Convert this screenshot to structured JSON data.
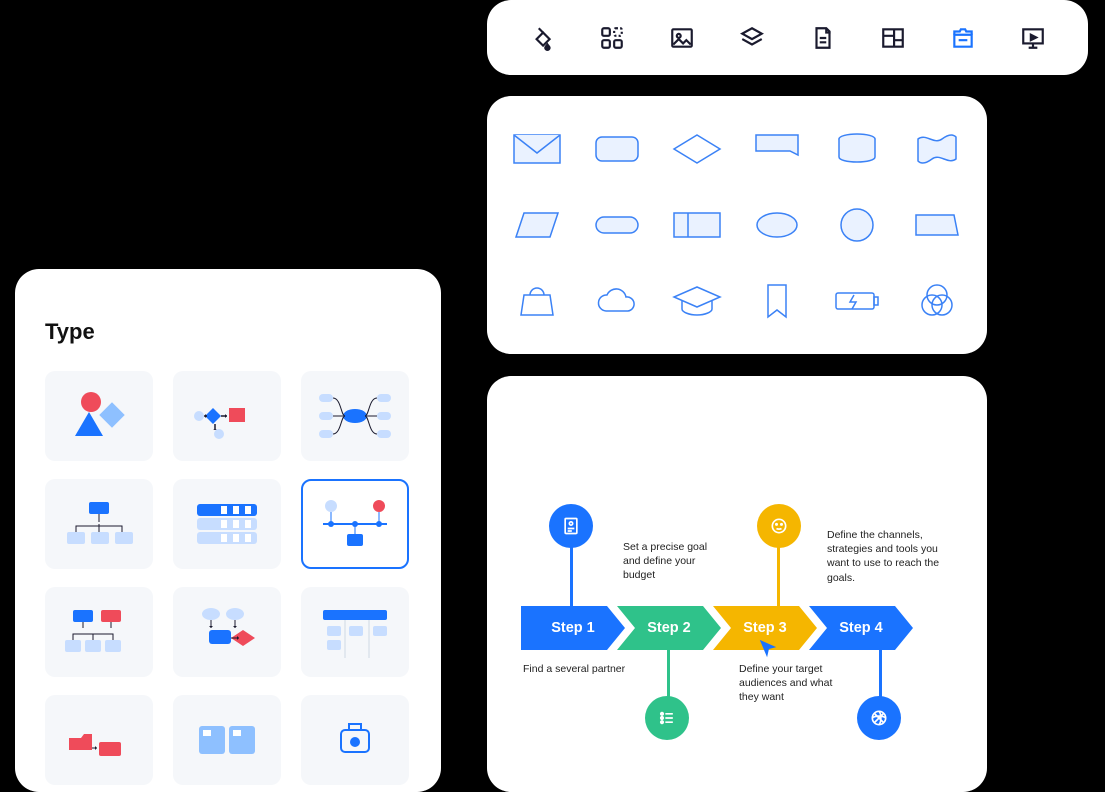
{
  "toolbar": {
    "items": [
      {
        "name": "fill-icon"
      },
      {
        "name": "apps-icon"
      },
      {
        "name": "image-icon"
      },
      {
        "name": "layers-icon"
      },
      {
        "name": "document-icon"
      },
      {
        "name": "layout-icon"
      },
      {
        "name": "templates-icon",
        "active": true
      },
      {
        "name": "presentation-icon"
      }
    ]
  },
  "shapes": {
    "items": [
      "envelope",
      "rounded-rect",
      "diamond",
      "flag",
      "cylinder",
      "wave-flag",
      "parallelogram",
      "pill",
      "split-rect",
      "ellipse",
      "circle",
      "trapezoid",
      "shopping-bag",
      "cloud",
      "graduation-cap",
      "bookmark",
      "battery",
      "venn"
    ]
  },
  "typePanel": {
    "title": "Type",
    "tiles": [
      {
        "name": "basic-shapes"
      },
      {
        "name": "flowchart"
      },
      {
        "name": "mindmap"
      },
      {
        "name": "org-chart"
      },
      {
        "name": "compare-table"
      },
      {
        "name": "timeline",
        "selected": true
      },
      {
        "name": "tree-diagram"
      },
      {
        "name": "decision-flow"
      },
      {
        "name": "kanban"
      },
      {
        "name": "folder-flow"
      },
      {
        "name": "cards"
      },
      {
        "name": "state"
      }
    ]
  },
  "steps": {
    "arrows": [
      {
        "label": "Step 1",
        "color": "c-blue"
      },
      {
        "label": "Step 2",
        "color": "c-green"
      },
      {
        "label": "Step 3",
        "color": "c-yellow"
      },
      {
        "label": "Step 4",
        "color": "c-blue2"
      }
    ],
    "desc_step1": "Find a several partner",
    "desc_step2": "Set a precise goal and define your budget",
    "desc_step3": "Define your target audiences and what they want",
    "desc_step4": "Define the channels, strategies and tools you want to use to reach the goals."
  }
}
